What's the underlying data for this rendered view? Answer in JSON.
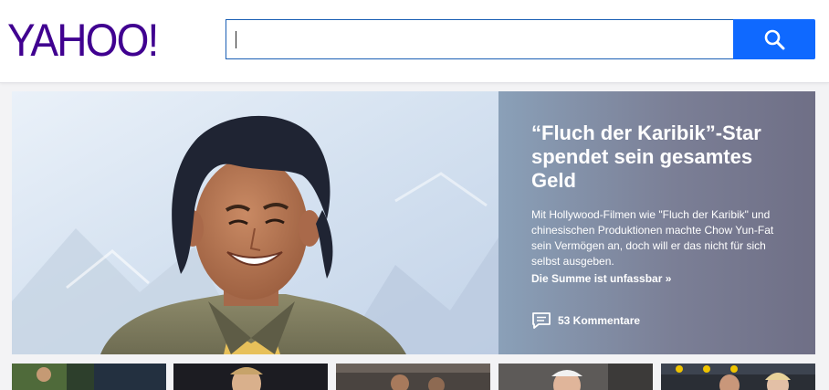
{
  "header": {
    "logo_text": "YAHOO!",
    "search": {
      "value": "",
      "placeholder": ""
    },
    "search_button_icon": "search-icon"
  },
  "hero": {
    "title": "“Fluch der Karibik”-Star spendet sein gesamtes Geld",
    "summary": "Mit Hollywood-Filmen wie \"Fluch der Karibik\" und chinesischen Produktionen machte Chow Yun-Fat sein Vermögen an, doch will er das nicht für sich selbst ausgeben.",
    "more_link": "Die Summe ist unfassbar »",
    "comments": "53 Kommentare",
    "comments_icon": "comment-icon"
  },
  "colors": {
    "brand": "#400090",
    "accent": "#0f69ff",
    "panel": "#7b7f96"
  }
}
